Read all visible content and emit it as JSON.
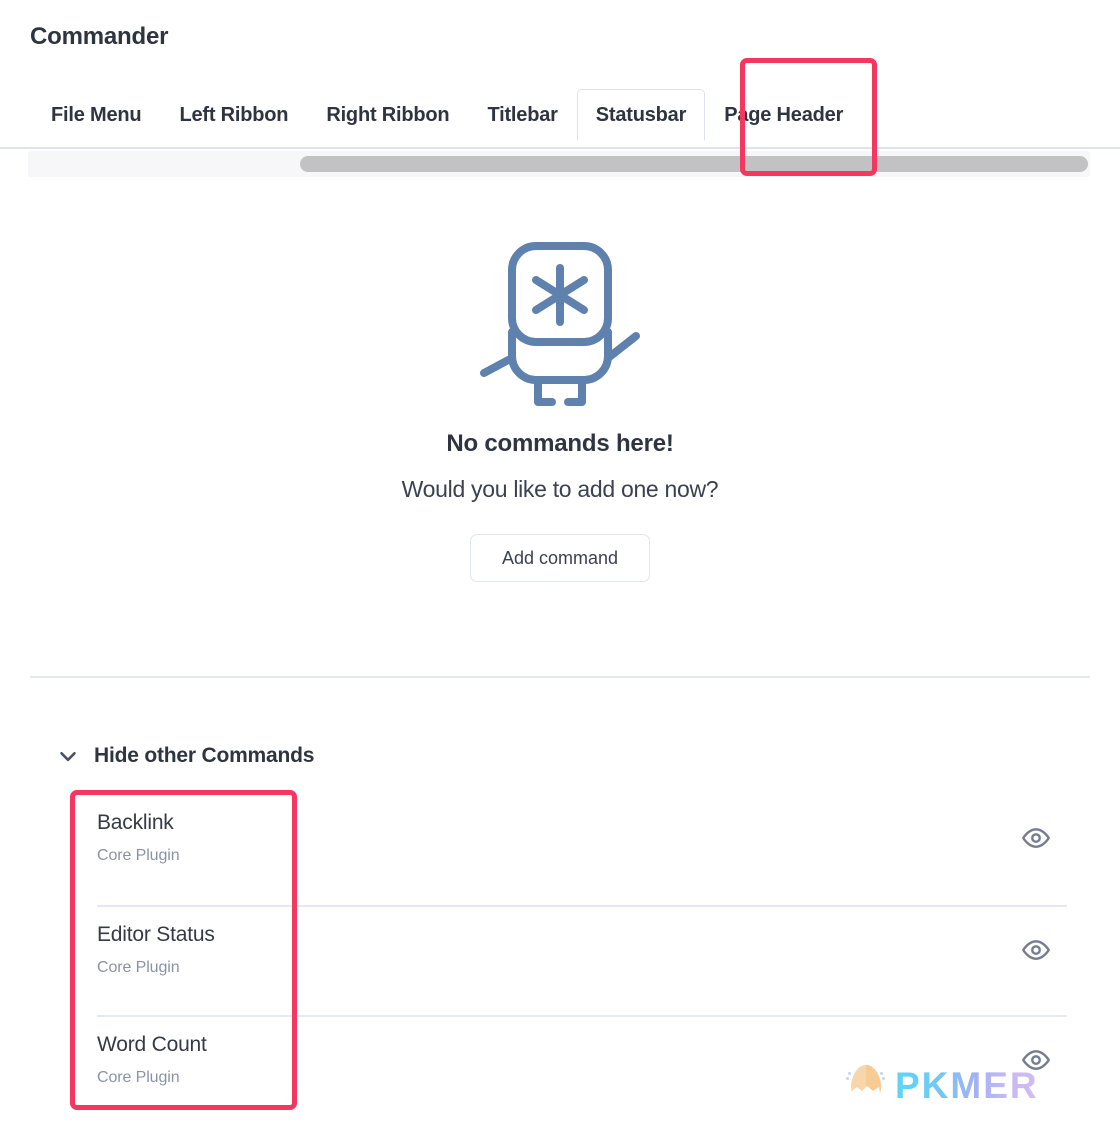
{
  "header": {
    "plugin_title": "Commander"
  },
  "tabs": {
    "items": [
      {
        "label": "File Menu",
        "active": false
      },
      {
        "label": "Left Ribbon",
        "active": false
      },
      {
        "label": "Right Ribbon",
        "active": false
      },
      {
        "label": "Titlebar",
        "active": false
      },
      {
        "label": "Statusbar",
        "active": true
      },
      {
        "label": "Page Header",
        "active": false
      }
    ],
    "selected": "Statusbar"
  },
  "scrollbar": {
    "orientation": "horizontal",
    "thumb_icon": "scrollbar-thumb"
  },
  "empty_state": {
    "illustration_icon": "robot-asterisk-illustration",
    "title": "No commands here!",
    "subtitle": "Would you like to add one now?",
    "add_button_label": "Add command"
  },
  "hide_section": {
    "chevron_icon": "chevron-down-icon",
    "title": "Hide other Commands",
    "expanded": true,
    "commands": [
      {
        "name": "Backlink",
        "source": "Core Plugin",
        "visibility_icon": "eye-icon"
      },
      {
        "name": "Editor Status",
        "source": "Core Plugin",
        "visibility_icon": "eye-icon"
      },
      {
        "name": "Word Count",
        "source": "Core Plugin",
        "visibility_icon": "eye-icon"
      }
    ]
  },
  "annotations": [
    {
      "name": "statusbar-tab-highlight",
      "color": "#f5375f"
    },
    {
      "name": "command-list-highlight",
      "color": "#f5375f"
    }
  ],
  "watermark": {
    "text": "PKMER",
    "egg_icon": "pkmer-egg-logo"
  },
  "colors": {
    "accent_red": "#f5375f",
    "text_primary": "#2e3440",
    "text_muted": "#8a93a5",
    "illustration_blue": "#5e82ad",
    "divider": "#e3e7f0"
  }
}
